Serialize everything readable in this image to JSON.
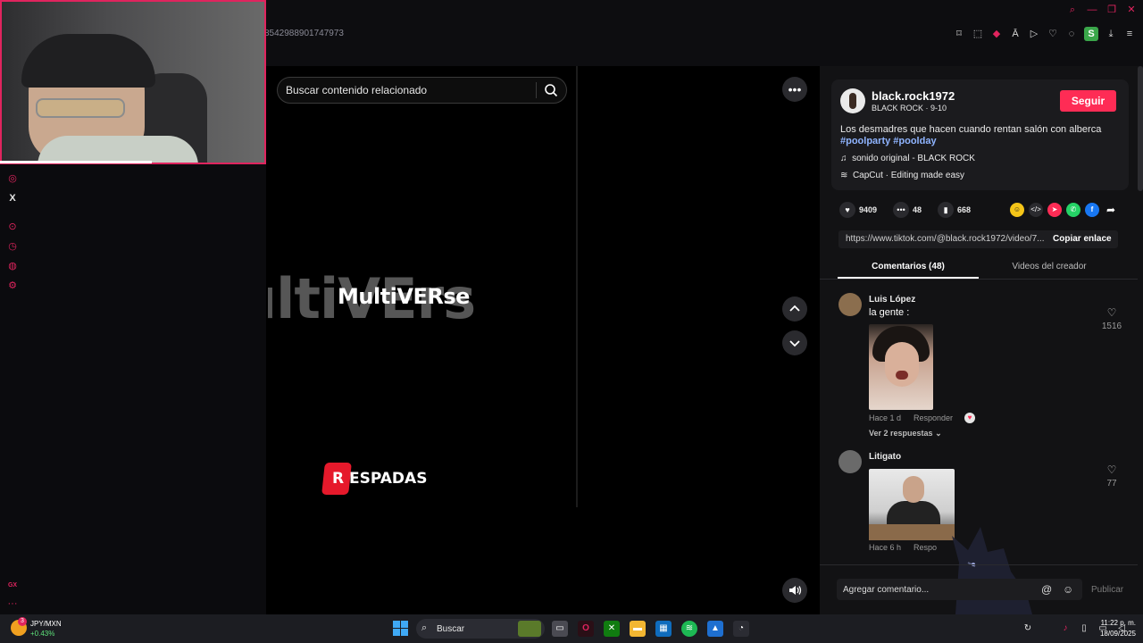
{
  "browser": {
    "url_fragment": "8542988901747973",
    "window_controls": [
      "search-icon",
      "minimize-icon",
      "maximize-icon",
      "close-icon"
    ],
    "extension_icons": [
      "bookmark-icon",
      "screenshot-icon",
      "pocket-icon",
      "translate-icon",
      "play-icon",
      "heart-icon",
      "chat-icon",
      "S",
      "download-icon",
      "menu-icon"
    ]
  },
  "sidebar": {
    "icons": [
      "instagram-icon",
      "x-icon",
      "player-icon",
      "history-icon",
      "messenger-icon",
      "settings-icon",
      "gx-icon",
      "more-icon"
    ],
    "x_label": "X",
    "gx_label": "GX"
  },
  "video": {
    "search_placeholder": "Buscar contenido relacionado",
    "overlay_big": "ultiVErs",
    "overlay_title": "MultiVERse",
    "overlay_badge": "R ESPADAS"
  },
  "controls": {
    "more_label": "•••",
    "up_label": "⌃",
    "down_label": "⌄",
    "volume_label": "🔊"
  },
  "post": {
    "username": "black.rock1972",
    "subinfo": "BLACK ROCK · 9-10",
    "follow_label": "Seguir",
    "description": "Los desmadres que hacen cuando rentan salón con alberca",
    "hashtags": "#poolparty #poolday",
    "music": "sonido original - BLACK ROCK",
    "capcut": "CapCut · Editing made easy",
    "likes": "9409",
    "comments": "48",
    "saves": "668",
    "link": "https://www.tiktok.com/@black.rock1972/video/7...",
    "copy_link_label": "Copiar enlace"
  },
  "tabs": {
    "comments_label": "Comentarios (48)",
    "videos_label": "Videos del creador"
  },
  "comments": [
    {
      "name": "Luis López",
      "text": "la gente :",
      "time": "Hace 1 d",
      "reply": "Responder",
      "likes": "1516",
      "replies_label": "Ver 2 respuestas"
    },
    {
      "name": "Litigato",
      "text": "",
      "time": "Hace 6 h",
      "reply": "Respo",
      "likes": "77"
    }
  ],
  "comment_box": {
    "placeholder": "Agregar comentario...",
    "publish_label": "Publicar"
  },
  "taskbar": {
    "ticker_name": "JPY/MXN",
    "ticker_change": "+0.43%",
    "ticker_badge": "3",
    "search_label": "Buscar",
    "time": "11:22 p. m.",
    "date": "18/09/2025"
  },
  "colors": {
    "accent": "#fe2c55",
    "opera_red": "#e0245e",
    "link_blue": "#8fb4ff"
  }
}
